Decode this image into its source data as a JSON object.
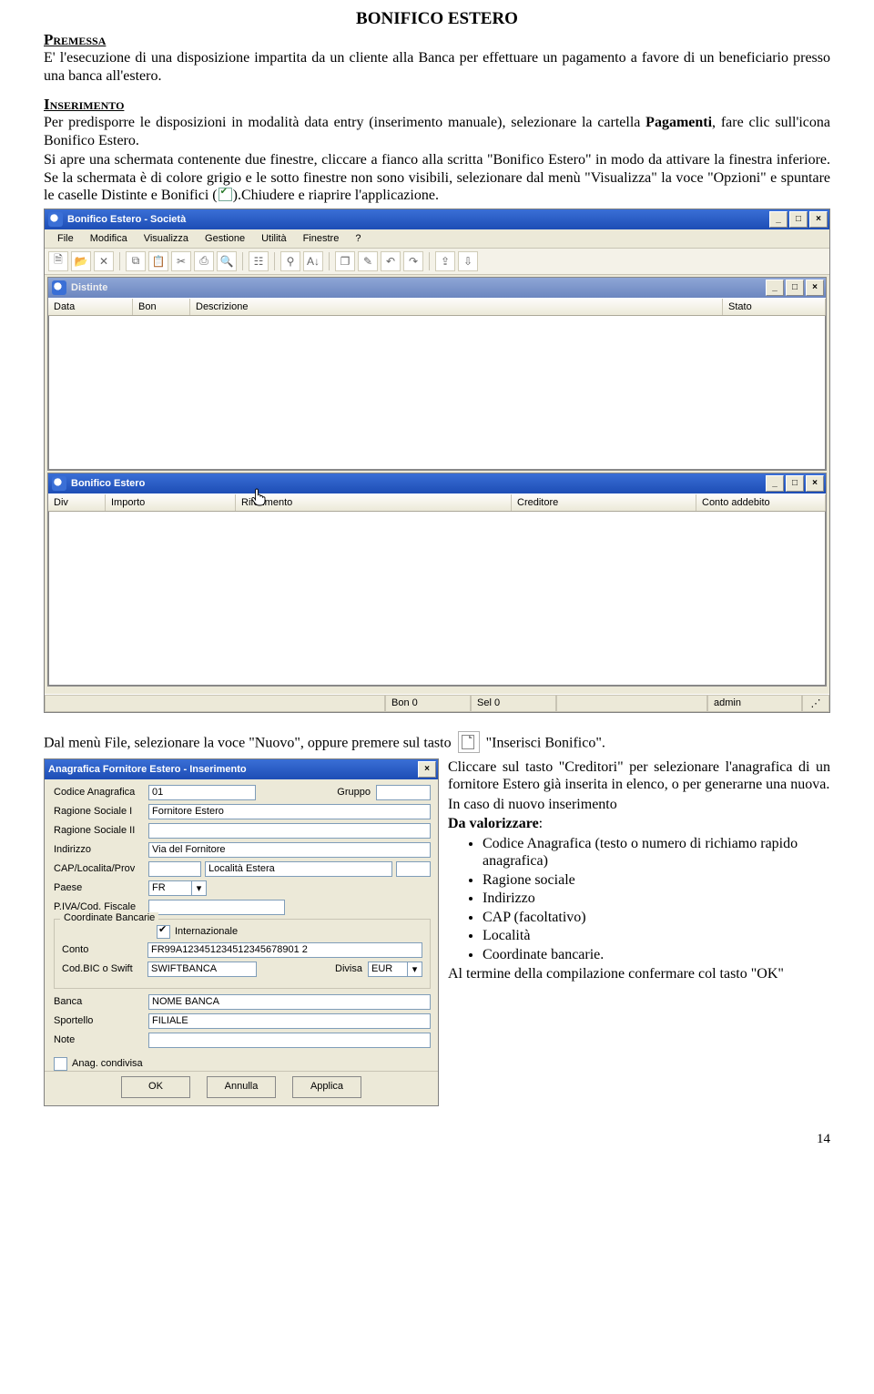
{
  "doc": {
    "title": "BONIFICO ESTERO",
    "premessa_hd": "Premessa",
    "premessa_body": "E' l'esecuzione di una disposizione impartita da un cliente alla Banca per effettuare un pagamento a favore di un beneficiario presso una banca all'estero.",
    "inserimento_hd": "Inserimento",
    "inserimento_p1a": "Per predisporre le disposizioni in modalità data entry (inserimento manuale), selezionare la cartella ",
    "inserimento_p1b": "Pagamenti",
    "inserimento_p1c": ", fare clic sull'icona Bonifico Estero.",
    "inserimento_p2": "Si apre una schermata contenente due finestre, cliccare a fianco alla scritta \"Bonifico Estero\" in modo da attivare la finestra inferiore. Se la schermata è di colore grigio e le sotto finestre non sono visibili, selezionare dal menù \"Visualizza\" la voce \"Opzioni\" e spuntare le caselle Distinte e Bonifici (",
    "inserimento_p2b": ").Chiudere e riaprire l'applicazione.",
    "after_img_a": "Dal menù File, selezionare la voce \"Nuovo\", oppure premere sul tasto ",
    "after_img_b": " \"Inserisci Bonifico\".",
    "right_p1": "Cliccare sul tasto \"Creditori\" per selezionare l'anagrafica di un fornitore Estero già inserita in elenco, o per generarne una nuova.",
    "right_p2": "In caso di nuovo inserimento",
    "right_p3": "Da valorizzare",
    "right_items": [
      "Codice Anagrafica (testo o numero di richiamo rapido anagrafica)",
      "Ragione sociale",
      "Indirizzo",
      "CAP (facoltativo)",
      "Località",
      "Coordinate bancarie."
    ],
    "right_p4": "Al termine della compilazione confermare col tasto \"OK\"",
    "pagenum": "14"
  },
  "app": {
    "main_title": "Bonifico Estero - Società",
    "menus": [
      "File",
      "Modifica",
      "Visualizza",
      "Gestione",
      "Utilità",
      "Finestre",
      "?"
    ],
    "distinte": {
      "title": "Distinte",
      "cols": [
        "Data",
        "Bon",
        "Descrizione",
        "Stato"
      ]
    },
    "bonifico": {
      "title": "Bonifico Estero",
      "cols": [
        "Div",
        "Importo",
        "Riferimento",
        "Creditore",
        "Conto addebito"
      ]
    },
    "status": {
      "bon": "Bon 0",
      "sel": "Sel 0",
      "user": "admin"
    }
  },
  "dlg": {
    "title": "Anagrafica Fornitore Estero - Inserimento",
    "labels": {
      "codice": "Codice Anagrafica",
      "gruppo": "Gruppo",
      "rag1": "Ragione Sociale I",
      "rag2": "Ragione Sociale II",
      "indir": "Indirizzo",
      "cap": "CAP/Localita/Prov",
      "paese": "Paese",
      "piva": "P.IVA/Cod. Fiscale",
      "coord": "Coordinate Bancarie",
      "intl": "Internazionale",
      "conto": "Conto",
      "bic": "Cod.BIC o Swift",
      "divisa": "Divisa",
      "banca": "Banca",
      "sportello": "Sportello",
      "note": "Note",
      "anag": "Anag. condivisa",
      "ok": "OK",
      "annulla": "Annulla",
      "applica": "Applica"
    },
    "values": {
      "codice": "01",
      "rag1": "Fornitore Estero",
      "indir": "Via del Fornitore",
      "localita": "Località Estera",
      "paese": "FR",
      "conto": "FR99A123451234512345678901 2",
      "bic": "SWIFTBANCA",
      "divisa": "EUR",
      "banca": "NOME BANCA",
      "sportello": "FILIALE"
    }
  }
}
